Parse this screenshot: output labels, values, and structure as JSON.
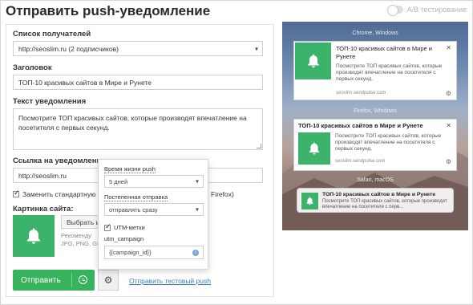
{
  "page": {
    "title": "Отправить push-уведомление",
    "ab_label": "A/B тестирование"
  },
  "form": {
    "recipients_label": "Список получателей",
    "recipients_value": "http://seoslim.ru (2 подписчиков)",
    "title_label": "Заголовок",
    "title_value": "ТОП-10 красивых сайтов в Мире и Рунете",
    "text_label": "Текст уведомления",
    "text_value": "Посмотрите ТОП красивых сайтов, которые производят впечатление на посетителя с первых секунд.",
    "link_label": "Ссылка на уведомление",
    "link_value": "http://seoslim.ru",
    "standard_checkbox_label_start": "Заменить стандартную",
    "standard_checkbox_label_end": "Firefox)",
    "image_label": "Картинка сайта:",
    "choose_button": "Выбрать и",
    "image_hint_line1": "Рекоменду",
    "image_hint_line2": "JPG, PNG, GIF",
    "send_button": "Отправить",
    "test_link": "Отправить тестовый push"
  },
  "popup": {
    "ttl_label": "Время жизни push",
    "ttl_value": "5 дней",
    "gradual_label": "Постепенная отправка",
    "gradual_value": "отправлять сразу",
    "utm_checkbox_label": "UTM-метки",
    "utm_campaign_label": "utm_campaign",
    "utm_campaign_value": "{{campaign_id}}"
  },
  "preview": {
    "chrome": {
      "os": "Chrome, Windows",
      "title": "ТОП-10 красивых сайтов в Мире и Рунете",
      "body": "Посмотрите ТОП красивых сайтов, которые производят впечатление на посетителя с первых секунд.",
      "site": "seoslim.sendpulse.com"
    },
    "firefox": {
      "os": "Firefox, Windows",
      "title": "ТОП-10 красивых сайтов в Мире и Рунете",
      "body": "Посмотрите ТОП красивых сайтов, которые производят впечатление на посетителя с первых секунд.",
      "site": "seoslim.sendpulse.com"
    },
    "safari": {
      "os": "Safari, macOS",
      "title": "ТОП-10 красивых сайтов в Мире и Рунете",
      "body": "Посмотрите ТОП красивых сайтов, которые производят впечатление на посетителя с перв..."
    }
  },
  "colors": {
    "accent_green": "#38b35d",
    "link_blue": "#3a7fc1"
  },
  "icons": {
    "bell": "bell-icon",
    "clock": "clock-icon",
    "gear": "gear-icon",
    "close": "close-icon",
    "info": "info-icon"
  }
}
